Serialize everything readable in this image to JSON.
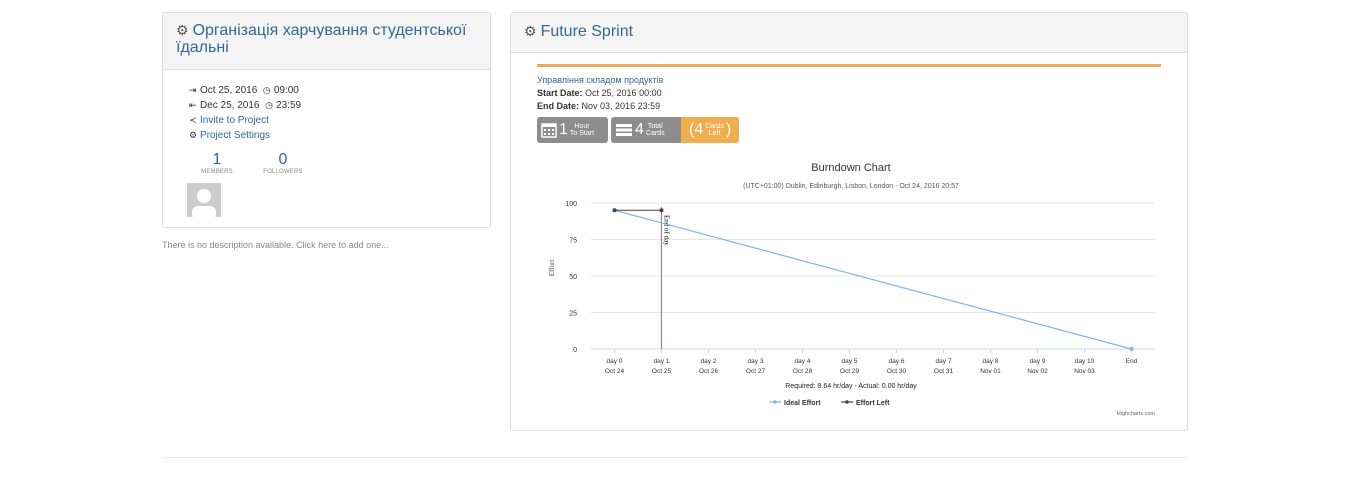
{
  "project": {
    "title": "Організація харчування студентської їдальні",
    "icon": "gear-icon",
    "start_date": "Oct 25, 2016",
    "start_time": "09:00",
    "end_date": "Dec 25, 2016",
    "end_time": "23:59",
    "invite_label": "Invite to Project",
    "settings_label": "Project Settings",
    "members_count": "1",
    "members_label": "MEMBERS",
    "followers_count": "0",
    "followers_label": "FOLLOWERS",
    "description": "There is no description available. Click here to add one..."
  },
  "sprint": {
    "title": "Future Sprint",
    "icon": "gears-icon",
    "product_link": "Управління складом продуктів",
    "start_label": "Start Date:",
    "start_value": "Oct 25, 2016 00:00",
    "end_label": "End Date:",
    "end_value": "Nov 03, 2016 23:59",
    "badges": {
      "hours_num": "1",
      "hours_l1": "Hour",
      "hours_l2": "To Start",
      "cards_num": "4",
      "cards_l1": "Total",
      "cards_l2": "Cards",
      "left_num": "(4",
      "left_l1": "Cards",
      "left_l2": "Left",
      "left_close": ")"
    },
    "accent_color": "#e7ad5a"
  },
  "chart_data": {
    "type": "line",
    "title": "Burndown Chart",
    "subtitle": "(UTC+01:00) Dublin, Edinburgh, Lisbon, London - Oct 24, 2016 20:57",
    "ylabel": "Effort",
    "ylim": [
      0,
      100
    ],
    "yticks": [
      0,
      25,
      50,
      75,
      100
    ],
    "categories": [
      "day 0",
      "day 1",
      "day 2",
      "day 3",
      "day 4",
      "day 5",
      "day 6",
      "day 7",
      "day 8",
      "day 9",
      "day 10",
      "End"
    ],
    "category_dates": [
      "Oct 24",
      "Oct 25",
      "Oct 26",
      "Oct 27",
      "Oct 28",
      "Oct 29",
      "Oct 30",
      "Oct 31",
      "Nov 01",
      "Nov 02",
      "Nov 03",
      ""
    ],
    "series": [
      {
        "name": "Ideal Effort",
        "color": "#7cb5ec",
        "points": [
          [
            0,
            95
          ],
          [
            11,
            0
          ]
        ]
      },
      {
        "name": "Effort Left",
        "color": "#434348",
        "points": [
          [
            0,
            95
          ],
          [
            1,
            95
          ]
        ]
      }
    ],
    "plot_line": {
      "category": "day 1",
      "label": "End of day",
      "color": "#e26060"
    },
    "footer": "Required: 8.64 hr/day - Actual: 0.00 hr/day",
    "credits": "Highcharts.com",
    "legend": "bottom-center",
    "grid": true
  }
}
